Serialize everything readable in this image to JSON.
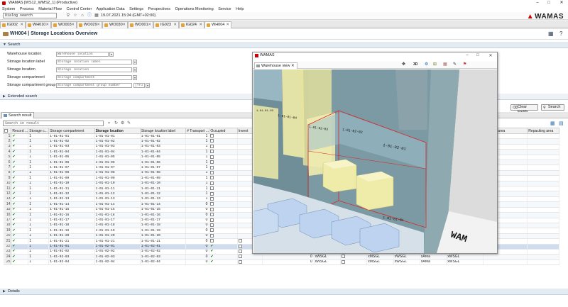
{
  "window": {
    "title": "WAMAS [WS12_WMS2_1] (Productive)",
    "controls": [
      "–",
      "□",
      "✕"
    ]
  },
  "menu": [
    "System",
    "Process",
    "Material Flow",
    "Control Center",
    "Application Data",
    "Settings",
    "Perspectives",
    "Operations Monitoring",
    "Service",
    "Help"
  ],
  "toolbar": {
    "search_placeholder": "Dialog search",
    "datetime": "19.07.2021 15:34 (GMT+02:00)",
    "brand": "WAMAS"
  },
  "tabs": [
    "IG002",
    "WH010",
    "WO003",
    "WO029",
    "WO030",
    "WO001",
    "IG023",
    "IG024",
    "WH004"
  ],
  "view": {
    "title": "WH004 | Storage Locations Overview"
  },
  "search": {
    "header": "Search",
    "fields": [
      {
        "label": "Warehouse location",
        "placeholder": "Warehouse location"
      },
      {
        "label": "Storage location label",
        "placeholder": "Storage location label"
      },
      {
        "label": "Storage location",
        "placeholder": "Storage location"
      },
      {
        "label": "Storage compartment",
        "placeholder": "Storage compartment"
      },
      {
        "label": "Storage compartment group",
        "placeholder": "Storage compartment group number",
        "extra": "[Tru"
      }
    ],
    "extended": "Extended search"
  },
  "result": {
    "tab": "Search result",
    "filter_placeholder": "Search in result",
    "clear_fields": "Clear Fields",
    "search_button": "Search",
    "columns": [
      "Record ...",
      "Storage c...",
      "Storage compartment",
      "Storage location",
      "Storage location label",
      "# Transport ...",
      "Occupied",
      "Invent",
      "",
      "",
      "",
      "",
      "Packing area",
      "Repacking area"
    ],
    "rows": [
      {
        "n": "1",
        "c": "1",
        "comp": "1-01-01-01",
        "loc": "1-01-01-01",
        "lbl": "1-01-01-01",
        "t": "1",
        "occ": false
      },
      {
        "n": "2",
        "c": "1",
        "comp": "1-01-01-02",
        "loc": "1-01-01-02",
        "lbl": "1-01-01-02",
        "t": "1",
        "occ": false
      },
      {
        "n": "3",
        "c": "1",
        "comp": "1-01-01-03",
        "loc": "1-01-01-03",
        "lbl": "1-01-01-03",
        "t": "1",
        "occ": false
      },
      {
        "n": "4",
        "c": "1",
        "comp": "1-01-01-04",
        "loc": "1-01-01-04",
        "lbl": "1-01-01-04",
        "t": "1",
        "occ": false
      },
      {
        "n": "5",
        "c": "1",
        "comp": "1-01-01-05",
        "loc": "1-01-01-05",
        "lbl": "1-01-01-05",
        "t": "1",
        "occ": false
      },
      {
        "n": "6",
        "c": "1",
        "comp": "1-01-01-06",
        "loc": "1-01-01-06",
        "lbl": "1-01-01-06",
        "t": "1",
        "occ": false
      },
      {
        "n": "7",
        "c": "1",
        "comp": "1-01-01-07",
        "loc": "1-01-01-07",
        "lbl": "1-01-01-07",
        "t": "1",
        "occ": false
      },
      {
        "n": "8",
        "c": "1",
        "comp": "1-01-01-08",
        "loc": "1-01-01-08",
        "lbl": "1-01-01-08",
        "t": "1",
        "occ": false
      },
      {
        "n": "9",
        "c": "1",
        "comp": "1-01-01-09",
        "loc": "1-01-01-09",
        "lbl": "1-01-01-09",
        "t": "1",
        "occ": false
      },
      {
        "n": "10",
        "c": "1",
        "comp": "1-01-01-10",
        "loc": "1-01-01-10",
        "lbl": "1-01-01-10",
        "t": "1",
        "occ": false
      },
      {
        "n": "11",
        "c": "1",
        "comp": "1-01-01-11",
        "loc": "1-01-01-11",
        "lbl": "1-01-01-11",
        "t": "1",
        "occ": false
      },
      {
        "n": "12",
        "c": "1",
        "comp": "1-01-01-12",
        "loc": "1-01-01-12",
        "lbl": "1-01-01-12",
        "t": "1",
        "occ": false
      },
      {
        "n": "13",
        "c": "1",
        "comp": "1-01-01-13",
        "loc": "1-01-01-13",
        "lbl": "1-01-01-13",
        "t": "1",
        "occ": false
      },
      {
        "n": "14",
        "c": "1",
        "comp": "1-01-01-14",
        "loc": "1-01-01-14",
        "lbl": "1-01-01-14",
        "t": "0",
        "occ": false
      },
      {
        "n": "15",
        "c": "1",
        "comp": "1-01-01-15",
        "loc": "1-01-01-15",
        "lbl": "1-01-01-15",
        "t": "0",
        "occ": false
      },
      {
        "n": "16",
        "c": "1",
        "comp": "1-01-01-16",
        "loc": "1-01-01-16",
        "lbl": "1-01-01-16",
        "t": "0",
        "occ": false
      },
      {
        "n": "17",
        "c": "1",
        "comp": "1-01-01-17",
        "loc": "1-01-01-17",
        "lbl": "1-01-01-17",
        "t": "0",
        "occ": false
      },
      {
        "n": "18",
        "c": "1",
        "comp": "1-01-01-18",
        "loc": "1-01-01-18",
        "lbl": "1-01-01-18",
        "t": "0",
        "occ": false
      },
      {
        "n": "19",
        "c": "1",
        "comp": "1-01-01-19",
        "loc": "1-01-01-19",
        "lbl": "1-01-01-19",
        "t": "0",
        "occ": false
      },
      {
        "n": "20",
        "c": "1",
        "comp": "1-01-01-20",
        "loc": "1-01-01-20",
        "lbl": "1-01-01-20",
        "t": "0",
        "occ": false
      },
      {
        "n": "21",
        "c": "1",
        "comp": "1-01-01-21",
        "loc": "1-01-01-21",
        "lbl": "1-01-01-21",
        "t": "0",
        "occ": false,
        "tail": [
          "0",
          "xWSGL",
          "xMSGL",
          "xWSGL",
          "xArea",
          "xWSGL"
        ]
      },
      {
        "n": "22",
        "c": "1",
        "comp": "1-01-02-01",
        "loc": "1-01-02-01",
        "lbl": "1-01-02-01",
        "t": "0",
        "occ": true,
        "sel": true,
        "tail": [
          "0",
          "xWSGL",
          "xMSGL",
          "xWSGL",
          "xArea",
          "xWSGL"
        ]
      },
      {
        "n": "23",
        "c": "1",
        "comp": "1-01-02-02",
        "loc": "1-01-02-02",
        "lbl": "1-01-02-02",
        "t": "0",
        "occ": true,
        "tail": [
          "0",
          "xWSGL",
          "xMSGL",
          "xWSGL",
          "xArea",
          "xWSGL"
        ]
      },
      {
        "n": "24",
        "c": "1",
        "comp": "1-01-02-03",
        "loc": "1-01-02-03",
        "lbl": "1-01-02-03",
        "t": "0",
        "occ": true,
        "tail": [
          "0",
          "xWSGL",
          "xMSGL",
          "xWSGL",
          "xArea",
          "xWSGL"
        ]
      },
      {
        "n": "25",
        "c": "1",
        "comp": "1-01-02-04",
        "loc": "1-01-02-04",
        "lbl": "1-01-02-04",
        "t": "0",
        "occ": true,
        "tail": [
          "0",
          "xWSGL",
          "xMSGL",
          "xWSGL",
          "xArea",
          "xWSGL"
        ]
      }
    ]
  },
  "details": "Details",
  "popup": {
    "title": "WAMAS",
    "tab": "Warehouse view",
    "controls": [
      "–",
      "□",
      "✕"
    ],
    "toolbar": [
      "✥",
      "3D",
      "⚙",
      "⊞",
      "▦",
      "✎",
      "⚑"
    ],
    "labels": [
      "1-01-01-04",
      "1-01-02-03",
      "1-01-02-02",
      "1-01-02-01",
      "1-01-01-03",
      "1-01-01-01"
    ],
    "floor_text": "WAM"
  }
}
